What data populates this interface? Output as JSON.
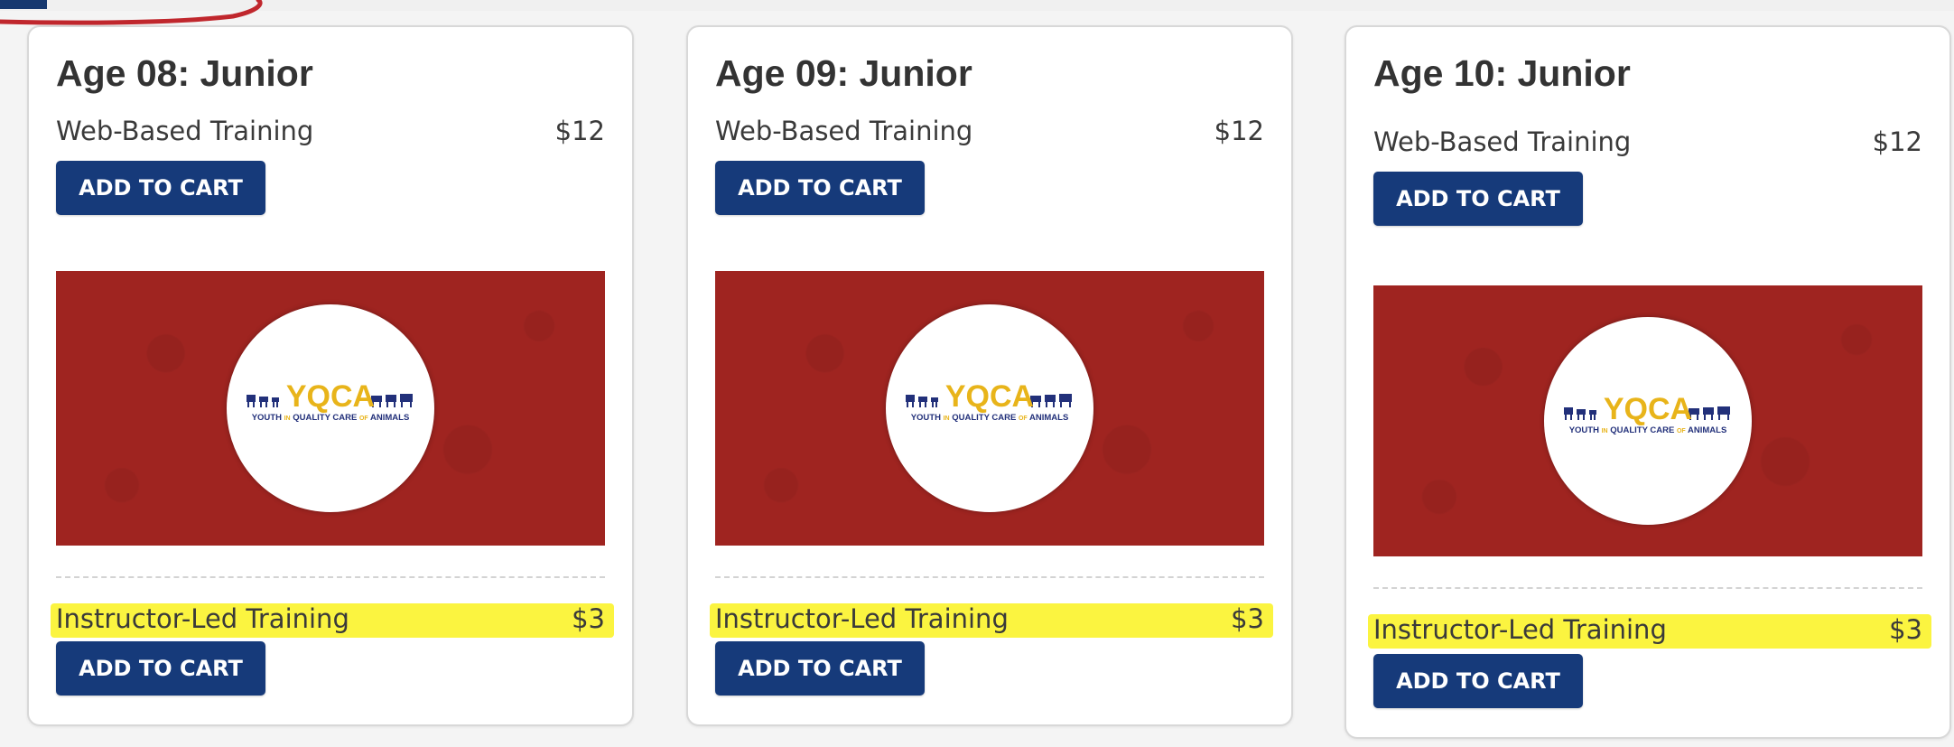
{
  "colors": {
    "primary_button": "#163a7a",
    "banner_red": "#9f2420",
    "highlight_yellow": "#fbf336",
    "annotation_red": "#c0272d",
    "logo_blue": "#22307a",
    "logo_yellow": "#e8b41a"
  },
  "icons": {
    "logo": "yqca-logo-icon",
    "annotation": "red-annotation-circle"
  },
  "cards": [
    {
      "title": "Age 08: Junior",
      "web_label": "Web-Based Training",
      "web_price": "$12",
      "web_button": "ADD TO CART",
      "instructor_label": "Instructor-Led Training",
      "instructor_price": "$3",
      "instructor_button": "ADD TO CART"
    },
    {
      "title": "Age 09: Junior",
      "web_label": "Web-Based Training",
      "web_price": "$12",
      "web_button": "ADD TO CART",
      "instructor_label": "Instructor-Led Training",
      "instructor_price": "$3",
      "instructor_button": "ADD TO CART"
    },
    {
      "title": "Age 10: Junior",
      "web_label": "Web-Based Training",
      "web_price": "$12",
      "web_button": "ADD TO CART",
      "instructor_label": "Instructor-Led Training",
      "instructor_price": "$3",
      "instructor_button": "ADD TO CART"
    }
  ],
  "logo": {
    "brand": "YQCA",
    "tagline_left": "YOUTH",
    "tagline_middle": "QUALITY CARE",
    "tagline_right": "ANIMALS",
    "tagline_connector_1": "IN",
    "tagline_connector_2": "OF"
  }
}
